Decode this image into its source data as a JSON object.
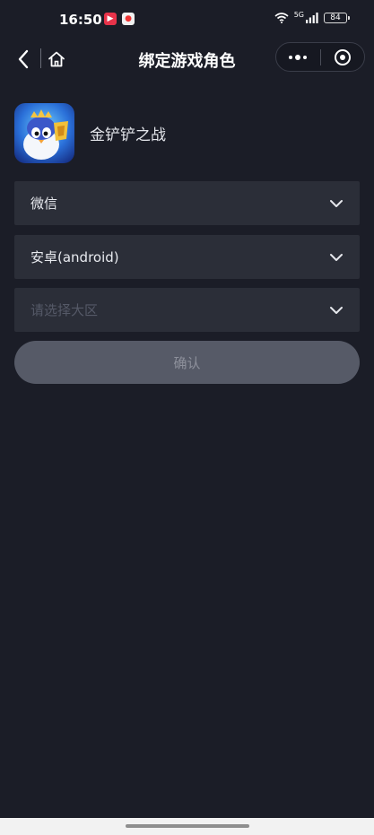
{
  "status_bar": {
    "time": "16:50",
    "network": "5G",
    "battery": "84",
    "icons": [
      "video-app-icon",
      "map-app-icon",
      "wifi-icon",
      "signal-icon",
      "battery-icon"
    ]
  },
  "nav": {
    "title": "绑定游戏角色",
    "icons": [
      "back-icon",
      "home-icon",
      "more-icon",
      "close-target-icon"
    ]
  },
  "game": {
    "name": "金铲铲之战",
    "logo": "game-logo-icon"
  },
  "form": {
    "platform_value": "微信",
    "os_value": "安卓(android)",
    "region_placeholder": "请选择大区",
    "confirm_label": "确认"
  },
  "colors": {
    "background": "#1b1d27",
    "field_background": "#2b2e38",
    "button_disabled": "#565a67"
  }
}
